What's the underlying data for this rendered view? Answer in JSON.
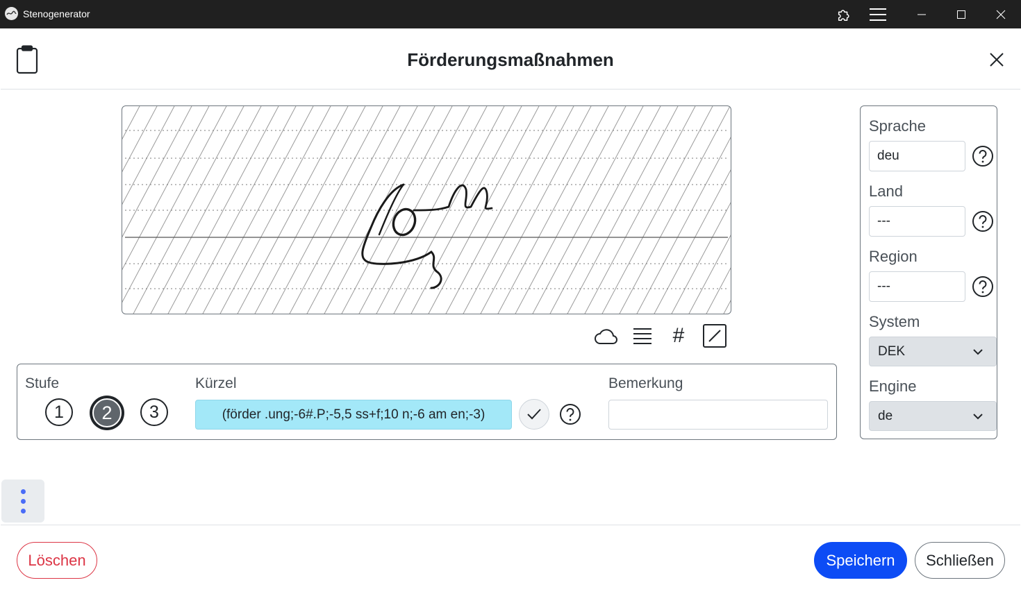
{
  "titlebar": {
    "app_title": "Stenogenerator",
    "icons": [
      "app-logo-icon",
      "extension-icon",
      "hamburger-menu-icon",
      "minimize-icon",
      "maximize-icon",
      "close-window-icon"
    ]
  },
  "header": {
    "title": "Förderungsmaßnahmen",
    "icons": [
      "clipboard-icon",
      "close-icon"
    ]
  },
  "canvas_tools": {
    "icons": [
      "cloud-icon",
      "lines-icon",
      "hash-icon",
      "edit-slash-icon"
    ],
    "hash_glyph": "#"
  },
  "stufe": {
    "label": "Stufe",
    "levels": [
      "1",
      "2",
      "3"
    ],
    "selected": "2"
  },
  "kuerzel": {
    "label": "Kürzel",
    "value": "(förder .ung;-6#.P;-5,5 ss+f;10 n;-6 am en;-3)"
  },
  "bemerkung": {
    "label": "Bemerkung",
    "value": ""
  },
  "side": {
    "sprache_label": "Sprache",
    "sprache_value": "deu",
    "land_label": "Land",
    "land_value": "---",
    "region_label": "Region",
    "region_value": "---",
    "system_label": "System",
    "system_value": "DEK",
    "engine_label": "Engine",
    "engine_value": "de"
  },
  "footer": {
    "delete_label": "Löschen",
    "save_label": "Speichern",
    "close_label": "Schließen"
  },
  "colors": {
    "titlebar": "#202020",
    "primary": "#0d4cf5",
    "danger": "#dc3545",
    "kuerzel_bg": "#a3e8f8",
    "menu_dots": "#4a6cf7"
  }
}
